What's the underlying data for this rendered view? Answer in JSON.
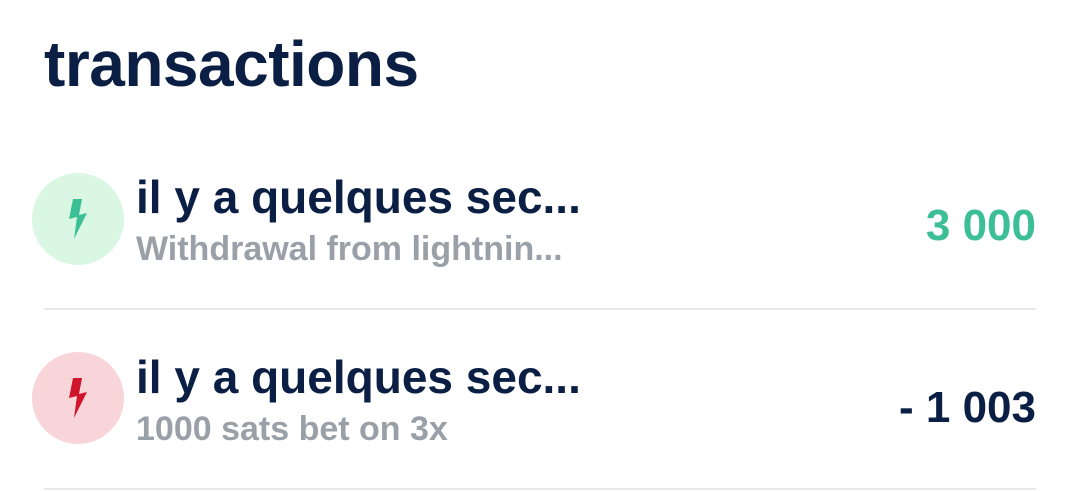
{
  "header": {
    "title": "transactions"
  },
  "transactions": [
    {
      "time": "il y a quelques sec...",
      "description": "Withdrawal from lightnin...",
      "amount": "3 000",
      "direction": "incoming",
      "icon": "lightning-bolt-icon",
      "color": "#3dbf95"
    },
    {
      "time": "il y a quelques sec...",
      "description": "1000 sats bet on 3x",
      "amount": "- 1 003",
      "direction": "outgoing",
      "icon": "lightning-bolt-icon",
      "color": "#d0142c"
    }
  ],
  "colors": {
    "text_primary": "#0b1f45",
    "text_secondary": "#9aa0a8",
    "incoming_accent": "#3dbf95",
    "incoming_bg": "#d9f7e2",
    "outgoing_accent": "#d0142c",
    "outgoing_bg": "#f8d5d8",
    "divider": "#e6e8ec"
  }
}
